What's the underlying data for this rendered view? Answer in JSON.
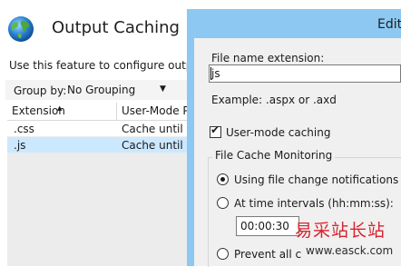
{
  "feature": {
    "title": "Output Caching",
    "description": "Use this feature to configure output c",
    "group_by_label": "Group by:",
    "group_by_value": "No Grouping",
    "columns": [
      "Extension",
      "User-Mode Po"
    ],
    "rows": [
      {
        "extension": ".css",
        "mode": "Cache until ch"
      },
      {
        "extension": ".js",
        "mode": "Cache until ch"
      }
    ]
  },
  "dialog": {
    "title": "Edit",
    "extension_label": "File name extension:",
    "extension_value": "js",
    "example": "Example: .aspx or .axd",
    "user_mode_caching_label": "User-mode caching",
    "user_mode_caching_checked": true,
    "file_cache_group": "File Cache Monitoring",
    "options": [
      {
        "label": "Using file change notifications",
        "selected": true
      },
      {
        "label": "At time intervals (hh:mm:ss):",
        "selected": false
      },
      {
        "label": "Prevent all c",
        "selected": false
      }
    ],
    "interval_value": "00:00:30"
  },
  "watermark": {
    "cjk": "易采站长站",
    "url": "www.easck.com"
  },
  "colors": {
    "dialog_frame": "#8cc8f2",
    "selected_row": "#cce8ff",
    "watermark_red": "#d9232e"
  },
  "icons": [
    "globe-icon",
    "dropdown-arrow-icon",
    "sort-ascending-icon",
    "checkmark-icon"
  ]
}
